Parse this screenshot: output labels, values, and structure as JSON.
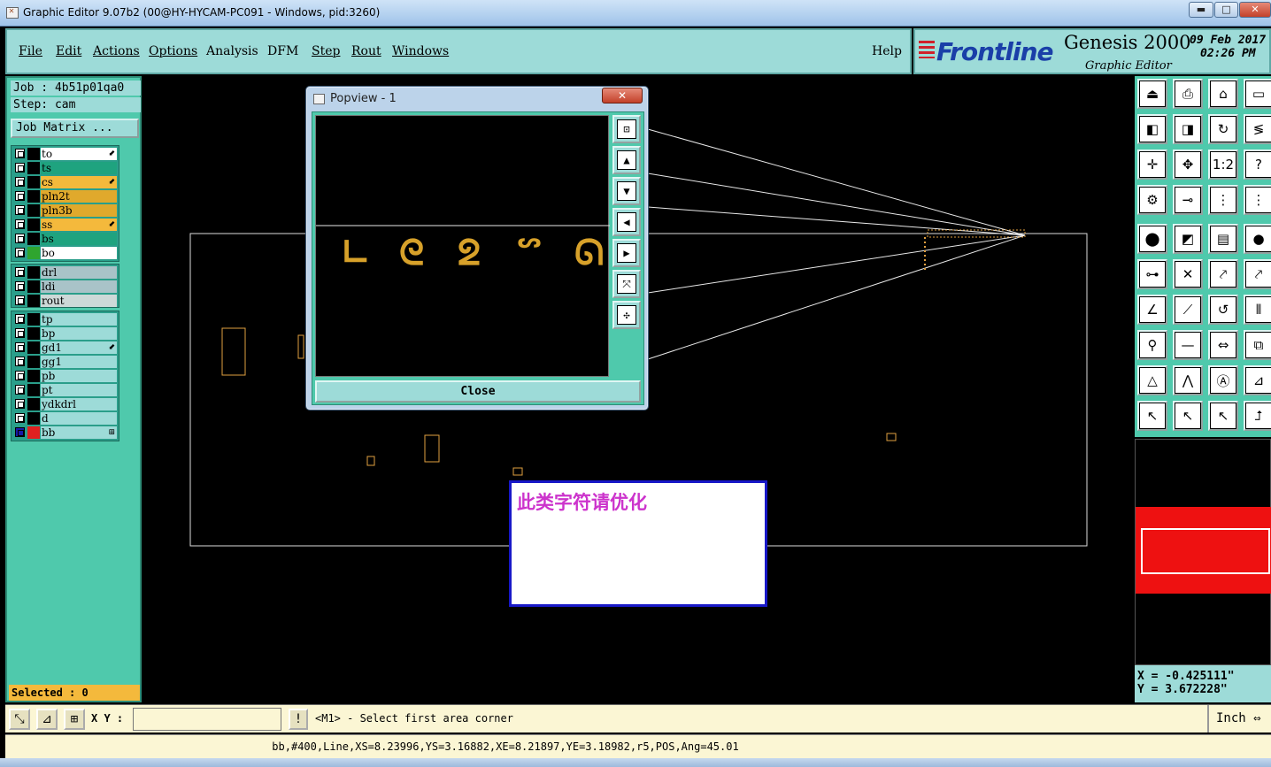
{
  "window": {
    "title": "Graphic Editor 9.07b2 (00@HY-HYCAM-PC091 - Windows, pid:3260)",
    "min_glyph": "▬",
    "max_glyph": "□",
    "close_glyph": "✕"
  },
  "menu": {
    "items": [
      "File",
      "Edit",
      "Actions",
      "Options",
      "Analysis",
      "DFM",
      "Step",
      "Rout",
      "Windows"
    ],
    "help": "Help"
  },
  "brand": {
    "logo": "Frontline",
    "product": "Genesis 2000",
    "subtitle": "Graphic Editor",
    "date": "09 Feb 2017",
    "time": "02:26 PM"
  },
  "job": {
    "job_line": "Job : 4b51p01qa0",
    "step_line": "Step: cam",
    "matrix_button": "Job Matrix ..."
  },
  "layers": {
    "group1": [
      {
        "name": "to",
        "color": "#ffffff",
        "mark": "⬋"
      },
      {
        "name": "ts",
        "color": "#1fa37f",
        "mark": ""
      },
      {
        "name": "cs",
        "color": "#f4b93c",
        "mark": "⬋"
      },
      {
        "name": "pln2t",
        "color": "#e0a92c",
        "mark": ""
      },
      {
        "name": "pln3b",
        "color": "#e0a92c",
        "mark": ""
      },
      {
        "name": "ss",
        "color": "#f4b93c",
        "mark": "⬋"
      },
      {
        "name": "bs",
        "color": "#1fa37f",
        "mark": ""
      },
      {
        "name": "bo",
        "color": "#ffffff",
        "mark": ""
      }
    ],
    "group2": [
      {
        "name": "drl",
        "color": "#a9c3c8",
        "mark": ""
      },
      {
        "name": "ldi",
        "color": "#a9c3c8",
        "mark": ""
      },
      {
        "name": "rout",
        "color": "#cdd9d8",
        "mark": ""
      }
    ],
    "group3": [
      {
        "name": "tp",
        "color": "#9ddbd8",
        "mark": ""
      },
      {
        "name": "bp",
        "color": "#9ddbd8",
        "mark": ""
      },
      {
        "name": "gd1",
        "color": "#9ddbd8",
        "mark": "⬋"
      },
      {
        "name": "gg1",
        "color": "#9ddbd8",
        "mark": ""
      },
      {
        "name": "pb",
        "color": "#9ddbd8",
        "mark": ""
      },
      {
        "name": "pt",
        "color": "#9ddbd8",
        "mark": ""
      },
      {
        "name": "ydkdrl",
        "color": "#9ddbd8",
        "mark": ""
      },
      {
        "name": "d",
        "color": "#9ddbd8",
        "mark": ""
      },
      {
        "name": "bb",
        "color": "#9ddbd8",
        "mark": "⊞"
      }
    ]
  },
  "selected": "Selected : 0",
  "popview": {
    "title": "Popview - 1",
    "close_label": "Close",
    "glyphs": [
      "∟",
      "ᘓ",
      "ᘖ",
      "ᔥ",
      "ᘏ"
    ]
  },
  "note": {
    "text": "此类字符请优化"
  },
  "coords": {
    "x": "X = -0.425111\"",
    "y": "Y = 3.672228\""
  },
  "command": {
    "xy_label": "X Y :",
    "xy_value": "",
    "bang": "!",
    "prompt": "<M1> - Select first area corner",
    "units": "Inch"
  },
  "status": {
    "text": "bb,#400,Line,XS=8.23996,YS=3.16882,XE=8.21897,YE=3.18982,r5,POS,Ang=45.01"
  }
}
